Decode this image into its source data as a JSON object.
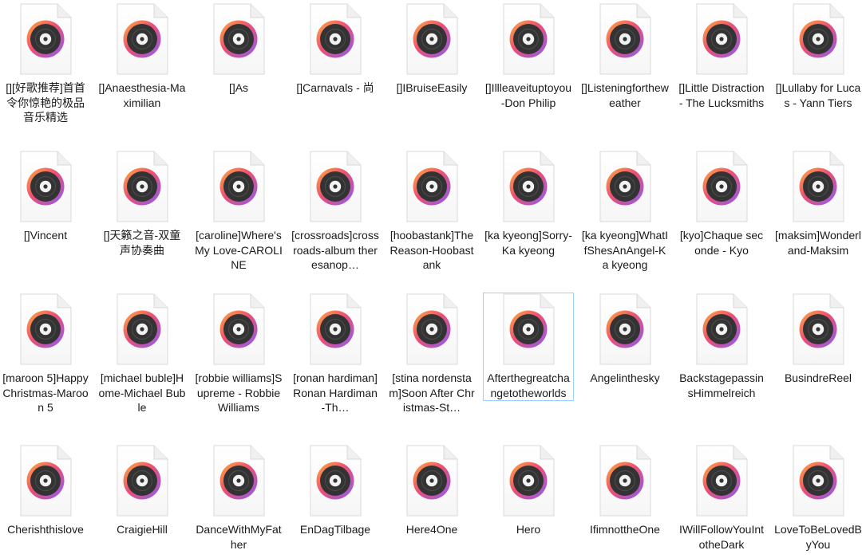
{
  "window": {
    "view_mode": "large-icons",
    "file_icon": "music-file-icon",
    "selected_index": 23
  },
  "files": [
    "[][好歌推荐]首首令你惊艳的极品音乐精选",
    "[]Anaesthesia-Maximilian",
    "[]As",
    "[]Carnavals - 尚",
    "[]IBruiseEasily",
    "[]Illleaveituptoyou-Don Philip",
    "[]Listeningfortheweather",
    "[]Little Distraction - The Lucksmiths",
    "[]Lullaby for Lucas - Yann Tiers",
    "[]Vincent",
    "[]天籁之音-双童声协奏曲",
    "[caroline]Where's My Love-CAROLINE",
    "[crossroads]crossroads-album theresanop…",
    "[hoobastank]The Reason-Hoobastank",
    "[ka kyeong]Sorry-Ka kyeong",
    "[ka kyeong]WhatIfShesAnAngel-Ka kyeong",
    "[kyo]Chaque seconde - Kyo",
    "[maksim]Wonderland-Maksim",
    "[maroon 5]Happy Christmas-Maroon 5",
    "[michael buble]Home-Michael Buble",
    "[robbie williams]Supreme - Robbie Williams",
    "[ronan hardiman]Ronan Hardiman-Th…",
    "[stina nordenstam]Soon After Christmas-St…",
    "Afterthegreatchangetotheworlds",
    "Angelinthesky",
    "BackstagepassinsHimmelreich",
    "BusindreReel",
    "Cherishthislove",
    "CraigieHill",
    "DanceWithMyFather",
    "EnDagTilbage",
    "Here4One",
    "Hero",
    "IfimnottheOne",
    "IWillFollowYouIntotheDark",
    "LoveToBeLovedByYou"
  ],
  "display_names": [
    "[][好歌推荐]首首令你惊艳的极品音乐精选",
    "[]Anaesthesia-Maximilian",
    "[]As",
    "[]Carnavals - 尚",
    "[]IBruiseEasily",
    "[]Illleaveituptoyou-Don Philip",
    "[]Listeningfortheweather",
    "[]Little Distraction - The Lucksmiths",
    "[]Lullaby for Lucas - Yann Tiers",
    "[]Vincent",
    "[]天籁之音-双童声协奏曲",
    "[caroline]Where's My Love-CAROLINE",
    "[crossroads]crossroads-album theresanop…",
    "[hoobastank]The Reason-Hoobastank",
    "[ka kyeong]Sorry-Ka kyeong",
    "[ka kyeong]WhatIfShesAnAngel-Ka kyeong",
    "[kyo]Chaque seconde - Kyo",
    "[maksim]Wonderland-Maksim",
    "[maroon 5]Happy Christmas-Maroon 5",
    "[michael buble]Home-Michael Buble",
    "[robbie williams]Supreme - Robbie Williams",
    "[ronan hardiman]Ronan Hardiman-Th…",
    "[stina nordenstam]Soon After Christmas-St…",
    "Afterthegreatchangetotheworlds",
    "Angelinthesky",
    "BackstagepassinsHimmelreich",
    "BusindreReel",
    "Cherishthislove",
    "CraigieHill",
    "DanceWithMyFather",
    "EnDagTilbage",
    "Here4One",
    "Hero",
    "IfimnottheOne",
    "IWillFollowYouIntotheDark",
    "LoveToBeLovedByYou"
  ],
  "colors": {
    "selection_border": "#99d1ff",
    "icon_gradient_start": "#ff9a3d",
    "icon_gradient_mid": "#ee4f73",
    "icon_gradient_end": "#8b5cf6",
    "disc": "#333333"
  }
}
